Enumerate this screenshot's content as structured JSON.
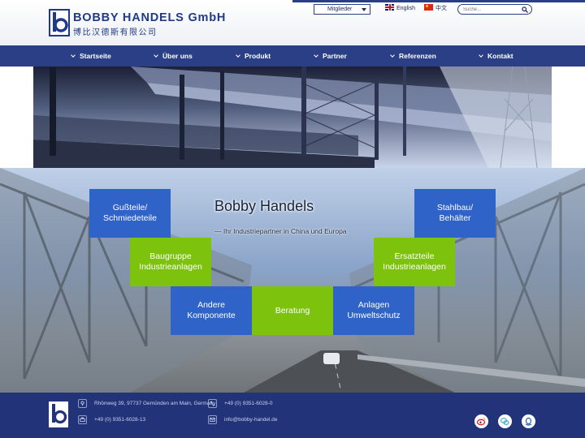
{
  "header": {
    "brand_name": "BOBBY HANDELS GmbH",
    "brand_name_cn": "博比汉德斯有限公司",
    "member_select": "Mitglieder",
    "languages": [
      {
        "label": "English",
        "flag": "uk-flag-icon"
      },
      {
        "label": "中文",
        "flag": "china-flag-icon"
      }
    ],
    "search_placeholder": "Suche...",
    "accent_color": "#2a3f86"
  },
  "nav": {
    "items": [
      {
        "label": "Startseite"
      },
      {
        "label": "Über uns"
      },
      {
        "label": "Produkt"
      },
      {
        "label": "Partner"
      },
      {
        "label": "Referenzen"
      },
      {
        "label": "Kontakt"
      }
    ]
  },
  "hero": {
    "title": "Bobby Handels",
    "subtitle": "— Ihr Industriepartner in China und Europa",
    "tiles": [
      {
        "label": "Gußteile/\nSchmiedeteile",
        "color": "#2f63c8"
      },
      {
        "label": "Baugruppe\nIndustrieanlagen",
        "color": "#7dc30e"
      },
      {
        "label": "Andere\nKomponente",
        "color": "#2f63c8"
      },
      {
        "label": "Beratung",
        "color": "#7dc30e"
      },
      {
        "label": "Anlagen\nUmweltschutz",
        "color": "#2f63c8"
      },
      {
        "label": "Ersatzteile\nIndustrieanlagen",
        "color": "#7dc30e"
      },
      {
        "label": "Stahlbau/\nBehälter",
        "color": "#2f63c8"
      }
    ]
  },
  "footer": {
    "address": "Rhönweg 39, 97737 Gemünden am Main, Germany",
    "phone": "+49 (0) 9351-6028-0",
    "fax": "+49 (0) 9351-6028-13",
    "email": "info@bobby-handel.de",
    "social": [
      "weibo-icon",
      "wechat-icon",
      "qq-icon"
    ]
  }
}
